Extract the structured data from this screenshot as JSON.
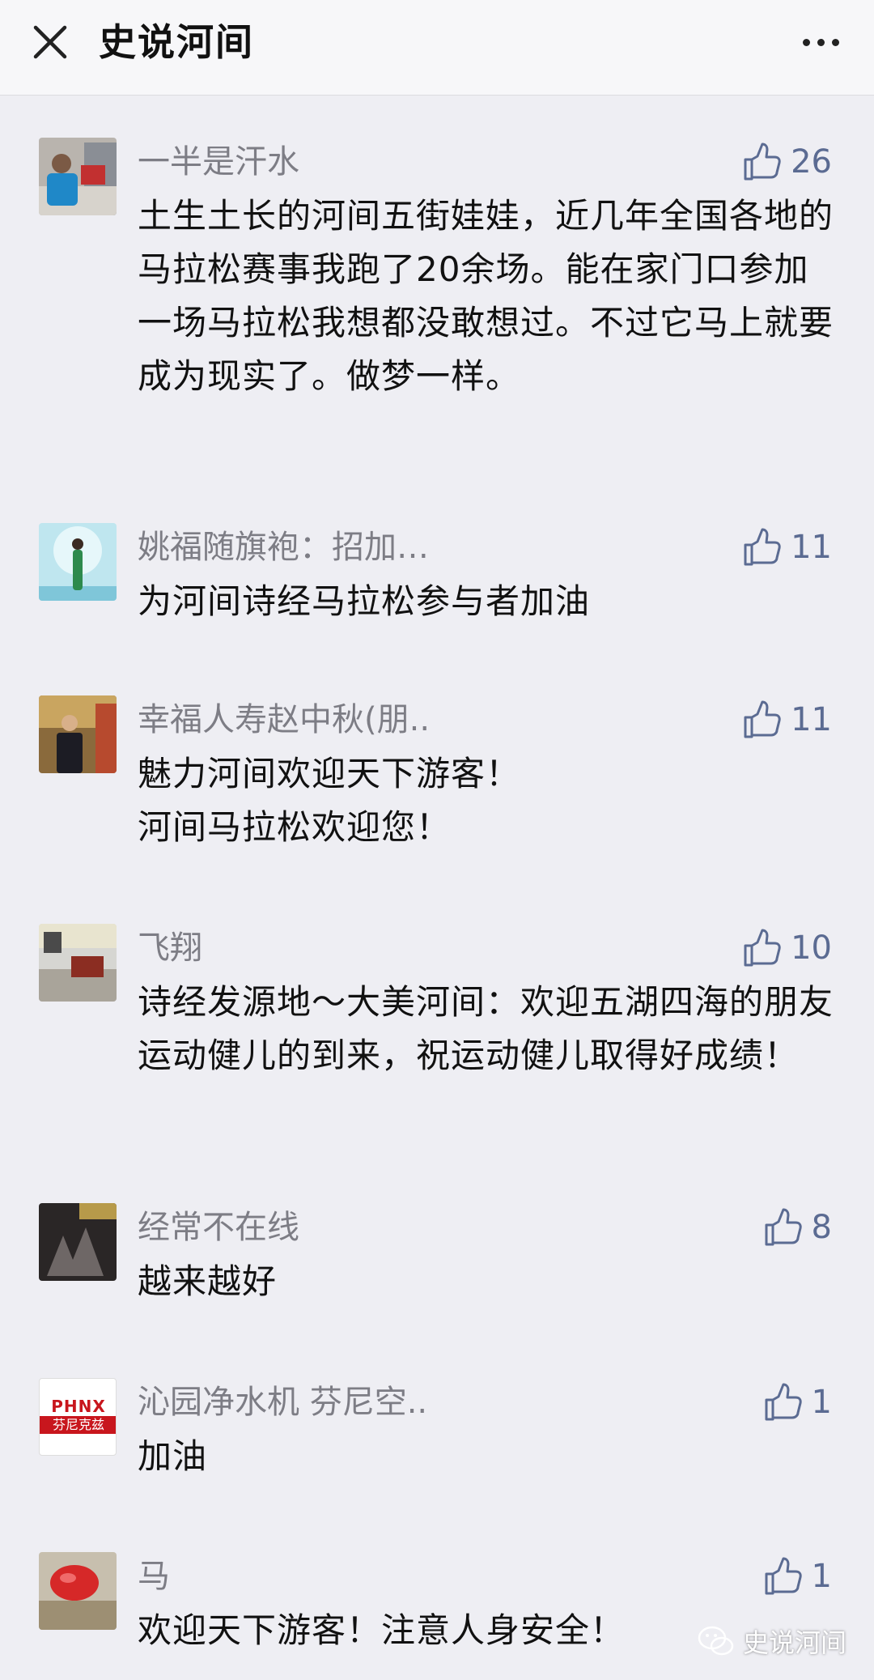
{
  "header": {
    "title": "史说河间"
  },
  "comments": [
    {
      "name": "一半是汗水",
      "likes": "26",
      "text": "土生土长的河间五街娃娃，近几年全国各地的马拉松赛事我跑了20余场。能在家门口参加一场马拉松我想都没敢想过。不过它马上就要成为现实了。做梦一样。"
    },
    {
      "name": "姚福随旗袍：招加…",
      "likes": "11",
      "text": "为河间诗经马拉松参与者加油"
    },
    {
      "name": "幸福人寿赵中秋(朋..",
      "likes": "11",
      "text": "魅力河间欢迎天下游客！\n河间马拉松欢迎您！"
    },
    {
      "name": "飞翔",
      "likes": "10",
      "text": "诗经发源地～大美河间：欢迎五湖四海的朋友运动健儿的到来，祝运动健儿取得好成绩！"
    },
    {
      "name": "经常不在线",
      "likes": "8",
      "text": "越来越好"
    },
    {
      "name": "沁园净水机 芬尼空..",
      "likes": "1",
      "text": "加油",
      "avatar_text": {
        "line1": "PHNX",
        "line2": "芬尼克兹"
      }
    },
    {
      "name": "马",
      "likes": "1",
      "text": "欢迎天下游客！注意人身安全！"
    }
  ],
  "watermark": {
    "text": "史说河间"
  },
  "colors": {
    "accent": "#5b6b92",
    "name": "#7d7d85",
    "background": "#eeeef3"
  },
  "icons": {
    "close": "close-icon",
    "more": "more-icon",
    "like": "thumbs-up-icon"
  }
}
